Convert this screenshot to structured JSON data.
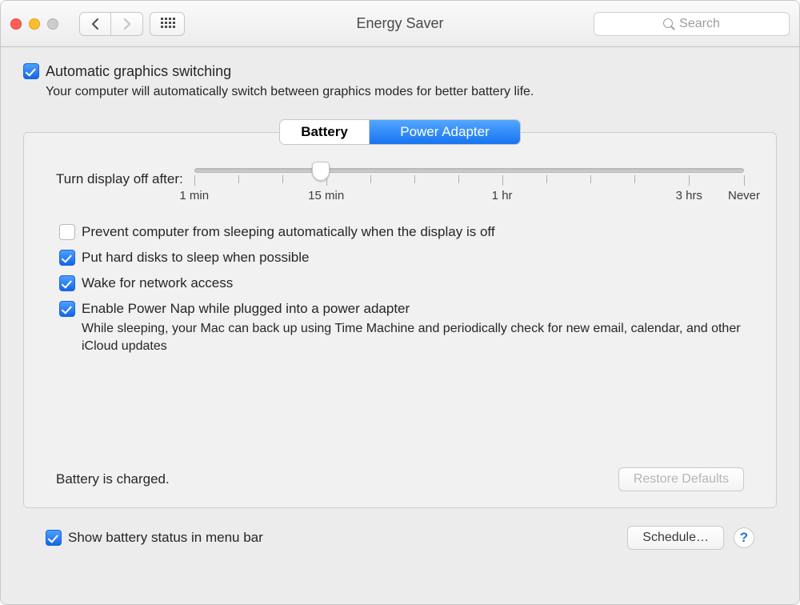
{
  "window": {
    "title": "Energy Saver"
  },
  "search": {
    "placeholder": "Search"
  },
  "auto_gfx": {
    "checked": true,
    "label": "Automatic graphics switching",
    "hint": "Your computer will automatically switch between graphics modes for better battery life."
  },
  "tabs": {
    "battery": "Battery",
    "adapter": "Power Adapter",
    "active": "adapter"
  },
  "slider": {
    "label": "Turn display off after:",
    "value_position_pct": 23,
    "ticks": {
      "min": "1 min",
      "fifteen": "15 min",
      "hour": "1 hr",
      "three": "3 hrs",
      "never": "Never"
    }
  },
  "options": {
    "prevent_sleep": {
      "checked": false,
      "label": "Prevent computer from sleeping automatically when the display is off"
    },
    "hdd_sleep": {
      "checked": true,
      "label": "Put hard disks to sleep when possible"
    },
    "wake_net": {
      "checked": true,
      "label": "Wake for network access"
    },
    "power_nap": {
      "checked": true,
      "label": "Enable Power Nap while plugged into a power adapter",
      "hint": "While sleeping, your Mac can back up using Time Machine and periodically check for new email, calendar, and other iCloud updates"
    }
  },
  "status": "Battery is charged.",
  "buttons": {
    "restore_defaults": "Restore Defaults",
    "schedule": "Schedule…"
  },
  "show_in_menubar": {
    "checked": true,
    "label": "Show battery status in menu bar"
  },
  "help": "?"
}
